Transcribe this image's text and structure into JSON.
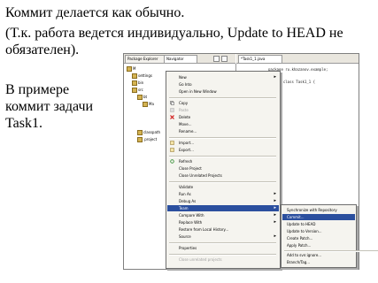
{
  "slide": {
    "line1": "Коммит делается как обычно.",
    "line2": "(Т.к. работа ведется индивидуально, Update to HEAD не",
    "line3": "обязателен).",
    "line4": "В примере",
    "line5": "коммит задачи",
    "line6": "Task1."
  },
  "screenshot": {
    "left_tabs": [
      {
        "label": "Package Explorer"
      },
      {
        "label": "Navigator"
      }
    ],
    "editor_tab": {
      "label": "*Task1_1.java"
    },
    "tree": [
      {
        "label": "M"
      },
      {
        "label": "settings"
      },
      {
        "label": "bin"
      },
      {
        "label": "src"
      },
      {
        "label": "bt"
      },
      {
        "label": "Ma"
      },
      {
        "label": "classpath"
      },
      {
        "label": ".project"
      }
    ],
    "code": [
      {
        "text": "package ru.khazanov.example;"
      },
      {
        "text": "public class Task1_1 {"
      },
      {
        "text": "}"
      }
    ],
    "context_menu": [
      {
        "label": "New",
        "arrow": true
      },
      {
        "label": "Go Into"
      },
      {
        "label": "Open in New Window"
      },
      {
        "label": "Copy",
        "icon": "copy-icon"
      },
      {
        "label": "Paste",
        "icon": "paste-icon",
        "disabled": true
      },
      {
        "label": "Delete",
        "icon": "delete-icon"
      },
      {
        "label": "Move..."
      },
      {
        "label": "Rename..."
      },
      {
        "label": "Import...",
        "icon": "import-icon"
      },
      {
        "label": "Export...",
        "icon": "export-icon"
      },
      {
        "label": "Refresh",
        "icon": "refresh-icon"
      },
      {
        "label": "Close Project"
      },
      {
        "label": "Close Unrelated Projects"
      },
      {
        "label": "Validate"
      },
      {
        "label": "Run As",
        "arrow": true
      },
      {
        "label": "Debug As",
        "arrow": true
      },
      {
        "label": "Team",
        "arrow": true,
        "selected": true
      },
      {
        "label": "Compare With",
        "arrow": true
      },
      {
        "label": "Replace With",
        "arrow": true
      },
      {
        "label": "Restore from Local History..."
      },
      {
        "label": "Source",
        "arrow": true
      },
      {
        "label": "Properties"
      },
      {
        "label": "Close unrelated projects"
      }
    ],
    "team_submenu": [
      {
        "label": "Synchronize with Repository"
      },
      {
        "label": "Commit...",
        "selected": true
      },
      {
        "label": "Update to HEAD"
      },
      {
        "label": "Update to Version..."
      },
      {
        "label": "Create Patch..."
      },
      {
        "label": "Apply Patch..."
      },
      {
        "label": "Add to svn:ignore..."
      },
      {
        "label": "Branch/Tag..."
      }
    ],
    "colors": {
      "selection": "#2b4f9e",
      "menu_bg": "#f5f4ef",
      "tab_bar": "#e9e6de"
    }
  }
}
